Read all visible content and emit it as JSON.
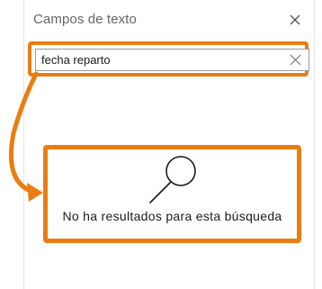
{
  "panel": {
    "title": "Campos de texto",
    "close_icon": "close-icon"
  },
  "search": {
    "value": "fecha reparto",
    "clear_icon": "clear-icon"
  },
  "empty_state": {
    "icon": "magnifier-icon",
    "message": "No ha resultados para esta búsqueda"
  },
  "annotation": {
    "highlight_color": "#e97d12"
  }
}
